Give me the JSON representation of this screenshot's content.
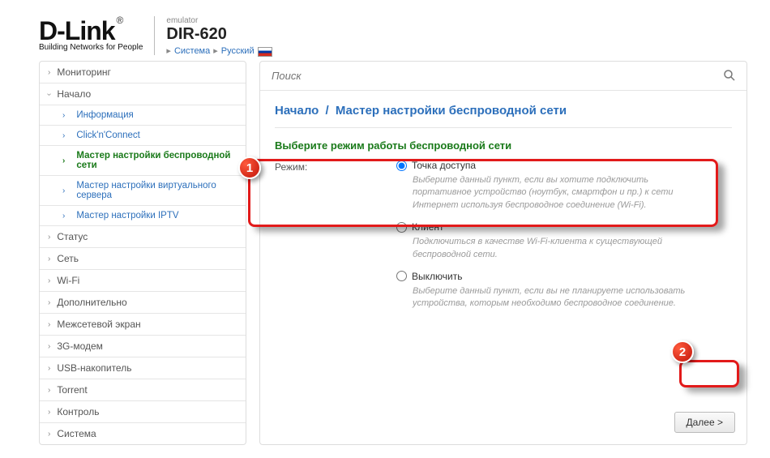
{
  "header": {
    "logo_text": "D-Link",
    "logo_sub": "Building Networks for People",
    "emulator_label": "emulator",
    "model": "DIR-620",
    "bc_system": "Система",
    "bc_lang": "Русский"
  },
  "search": {
    "placeholder": "Поиск"
  },
  "sidebar": [
    {
      "label": "Мониторинг",
      "type": "item"
    },
    {
      "label": "Начало",
      "type": "item",
      "expanded": true,
      "children": [
        {
          "label": "Информация"
        },
        {
          "label": "Click'n'Connect"
        },
        {
          "label": "Мастер настройки беспроводной сети",
          "active": true
        },
        {
          "label": "Мастер настройки виртуального сервера"
        },
        {
          "label": "Мастер настройки IPTV"
        }
      ]
    },
    {
      "label": "Статус",
      "type": "item"
    },
    {
      "label": "Сеть",
      "type": "item"
    },
    {
      "label": "Wi-Fi",
      "type": "item"
    },
    {
      "label": "Дополнительно",
      "type": "item"
    },
    {
      "label": "Межсетевой экран",
      "type": "item"
    },
    {
      "label": "3G-модем",
      "type": "item"
    },
    {
      "label": "USB-накопитель",
      "type": "item"
    },
    {
      "label": "Torrent",
      "type": "item"
    },
    {
      "label": "Контроль",
      "type": "item"
    },
    {
      "label": "Система",
      "type": "item"
    }
  ],
  "breadcrumb": {
    "root": "Начало",
    "current": "Мастер настройки беспроводной сети"
  },
  "section_title": "Выберите режим работы беспроводной сети",
  "form": {
    "mode_label": "Режим:",
    "options": [
      {
        "name": "Точка доступа",
        "desc": "Выберите данный пункт, если вы хотите подключить портативное устройство (ноутбук, смартфон и пр.) к сети Интернет используя беспроводное соединение (Wi-Fi).",
        "checked": true
      },
      {
        "name": "Клиент",
        "desc": "Подключиться в качестве Wi-Fi-клиента к существующей беспроводной сети.",
        "checked": false
      },
      {
        "name": "Выключить",
        "desc": "Выберите данный пункт, если вы не планируете использовать устройства, которым необходимо беспроводное соединение.",
        "checked": false
      }
    ]
  },
  "buttons": {
    "next": "Далее >"
  },
  "annotations": {
    "b1": "1",
    "b2": "2"
  }
}
